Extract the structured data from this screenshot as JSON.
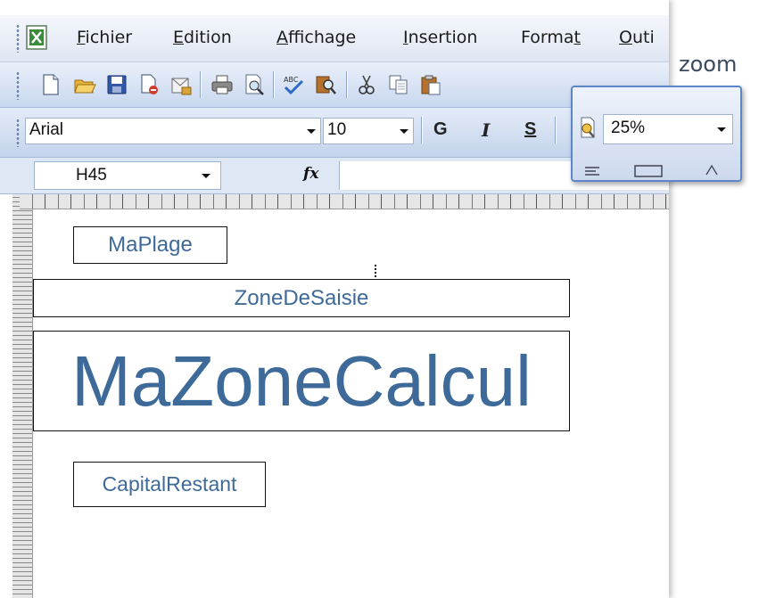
{
  "menu": {
    "fichier": {
      "first": "F",
      "rest": "ichier"
    },
    "edition": {
      "first": "E",
      "rest": "dition"
    },
    "affichage": {
      "first": "A",
      "rest": "ffichage"
    },
    "insertion": {
      "first": "I",
      "rest": "nsertion"
    },
    "format": {
      "before": "Forma",
      "under": "t"
    },
    "outils": {
      "first": "O",
      "rest": "uti"
    }
  },
  "format_toolbar": {
    "font": "Arial",
    "size": "10",
    "bold": "G",
    "italic": "I",
    "underline": "S"
  },
  "formula_bar": {
    "name_box": "H45",
    "fx": "fx"
  },
  "zoom": {
    "label": "zoom",
    "value": "25%"
  },
  "ranges": [
    {
      "label": "MaPlage"
    },
    {
      "label": "ZoneDeSaisie"
    },
    {
      "label": "MaZoneCalcul"
    },
    {
      "label": "CapitalRestant"
    }
  ],
  "colors": {
    "range_text": "#3e6a9a",
    "toolbar_accent": "#5b86c8"
  }
}
